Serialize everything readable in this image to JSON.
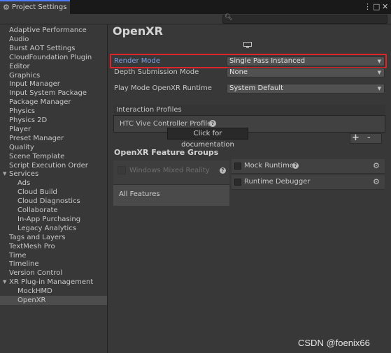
{
  "window": {
    "tab_title": "Project Settings",
    "icons": [
      "gear-icon",
      "kebab-menu-icon",
      "maximize-icon",
      "close-icon"
    ]
  },
  "search": {
    "placeholder": ""
  },
  "sidebar": {
    "items": [
      {
        "label": "Adaptive Performance",
        "indent": 0
      },
      {
        "label": "Audio",
        "indent": 0
      },
      {
        "label": "Burst AOT Settings",
        "indent": 0
      },
      {
        "label": "CloudFoundation Plugin",
        "indent": 0
      },
      {
        "label": "Editor",
        "indent": 0
      },
      {
        "label": "Graphics",
        "indent": 0
      },
      {
        "label": "Input Manager",
        "indent": 0
      },
      {
        "label": "Input System Package",
        "indent": 0
      },
      {
        "label": "Package Manager",
        "indent": 0
      },
      {
        "label": "Physics",
        "indent": 0
      },
      {
        "label": "Physics 2D",
        "indent": 0
      },
      {
        "label": "Player",
        "indent": 0
      },
      {
        "label": "Preset Manager",
        "indent": 0
      },
      {
        "label": "Quality",
        "indent": 0
      },
      {
        "label": "Scene Template",
        "indent": 0
      },
      {
        "label": "Script Execution Order",
        "indent": 0
      },
      {
        "label": "Services",
        "indent": 0,
        "expandable": true
      },
      {
        "label": "Ads",
        "indent": 1
      },
      {
        "label": "Cloud Build",
        "indent": 1
      },
      {
        "label": "Cloud Diagnostics",
        "indent": 1
      },
      {
        "label": "Collaborate",
        "indent": 1
      },
      {
        "label": "In-App Purchasing",
        "indent": 1
      },
      {
        "label": "Legacy Analytics",
        "indent": 1
      },
      {
        "label": "Tags and Layers",
        "indent": 0
      },
      {
        "label": "TextMesh Pro",
        "indent": 0
      },
      {
        "label": "Time",
        "indent": 0
      },
      {
        "label": "Timeline",
        "indent": 0
      },
      {
        "label": "Version Control",
        "indent": 0
      },
      {
        "label": "XR Plug-in Management",
        "indent": 0,
        "expandable": true
      },
      {
        "label": "MockHMD",
        "indent": 1
      },
      {
        "label": "OpenXR",
        "indent": 1,
        "selected": true
      }
    ]
  },
  "main": {
    "title": "OpenXR",
    "platform_icon": "monitor-icon",
    "render_mode": {
      "label": "Render Mode",
      "value": "Single Pass Instanced"
    },
    "depth_submission": {
      "label": "Depth Submission Mode",
      "value": "None"
    },
    "play_mode_runtime": {
      "label": "Play Mode OpenXR Runtime",
      "value": "System Default"
    },
    "interaction_profiles": {
      "title": "Interaction Profiles",
      "items": [
        "HTC Vive Controller Profile"
      ],
      "help_glyph": "?",
      "tooltip": "Click for documentation",
      "add_label": "+",
      "remove_label": "-"
    },
    "feature_groups": {
      "title": "OpenXR Feature Groups",
      "groups": [
        "Windows Mixed Reality",
        "All Features"
      ],
      "features": [
        {
          "label": "Mock Runtime",
          "has_help": true
        },
        {
          "label": "Runtime Debugger",
          "has_help": false
        }
      ]
    }
  },
  "watermark": "CSDN @foenix66",
  "colors": {
    "highlight": "#e0252a",
    "accent": "#4c7eff",
    "background": "#383838"
  }
}
